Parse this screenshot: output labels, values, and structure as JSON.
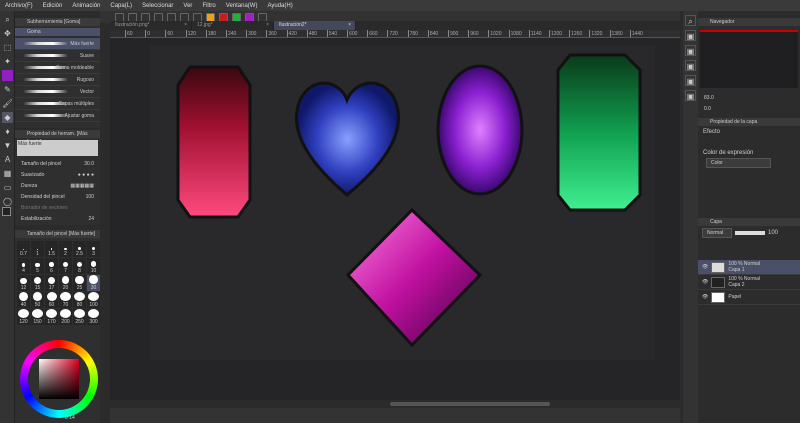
{
  "menu": [
    "Archivo(F)",
    "Edición",
    "Animación",
    "Capa(L)",
    "Seleccionar",
    "Ver",
    "Filtro",
    "Ventana(W)",
    "Ayuda(H)"
  ],
  "tabs": [
    {
      "label": "Ilustración.png*"
    },
    {
      "label": "12.jpg*"
    },
    {
      "label": "Ilustración2*"
    }
  ],
  "ruler": [
    "60",
    "0",
    "60",
    "120",
    "180",
    "240",
    "300",
    "360",
    "420",
    "480",
    "540",
    "600",
    "660",
    "720",
    "780",
    "840",
    "900",
    "960",
    "1020",
    "1080",
    "1140",
    "1200",
    "1260",
    "1320",
    "1380",
    "1440"
  ],
  "subtool": {
    "title": "Subherramienta [Goma]",
    "group": "Goma",
    "items": [
      "Más fuerte",
      "Suave",
      "Goma moldeable",
      "Rugoso",
      "Vector",
      "Capas múltiples",
      "Ajustar goma"
    ]
  },
  "toolprop": {
    "title": "Propiedad de herram. [Más fuerte]",
    "preset": "Más fuerte",
    "size_label": "Tamaño del pincel",
    "size_value": "30.0",
    "smooth_label": "Suavizado",
    "hardness_label": "Dureza",
    "density_label": "Densidad del pincel",
    "density_value": "100",
    "vector_label": "Borrador de vectores",
    "stab_label": "Estabilización",
    "stab_value": "24"
  },
  "brushsize": {
    "title": "Tamaño del pincel [Más fuerte]",
    "sizes": [
      "0.7",
      "1",
      "1.5",
      "2",
      "2.5",
      "3",
      "4",
      "5",
      "6",
      "7",
      "8",
      "10",
      "12",
      "15",
      "17",
      "20",
      "25",
      "30",
      "40",
      "50",
      "60",
      "70",
      "80",
      "100",
      "120",
      "150",
      "170",
      "200",
      "250",
      "300"
    ]
  },
  "color": {
    "readout": "0 14"
  },
  "navigator": {
    "title": "Navegador",
    "zoom": "83.0",
    "angle": "0.0"
  },
  "layerprop": {
    "title": "Propiedad de la capa",
    "effect_label": "Efecto",
    "expr_label": "Color de expresión",
    "expr_value": "Color"
  },
  "layers": {
    "title": "Capa",
    "blend": "Normal",
    "opacity": "100",
    "items": [
      {
        "mode": "100 % Normal",
        "name": "Capa 1"
      },
      {
        "mode": "100 % Normal",
        "name": "Capa 2"
      },
      {
        "mode": "",
        "name": "Papel"
      }
    ]
  }
}
